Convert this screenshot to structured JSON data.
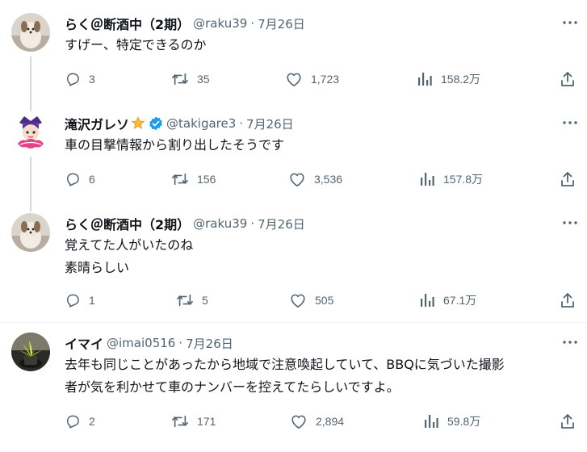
{
  "tweets": [
    {
      "name": "らく＠断酒中（2期）",
      "handle": "@raku39",
      "separator": "·",
      "date": "7月26日",
      "verified": false,
      "lines": [
        "すげー、特定できるのか"
      ],
      "replies": "3",
      "retweets": "35",
      "likes": "1,723",
      "views": "158.2万"
    },
    {
      "name": "滝沢ガレソ",
      "name_emoji": "star-emoji",
      "handle": "@takigare3",
      "separator": "·",
      "date": "7月26日",
      "verified": true,
      "lines": [
        "車の目撃情報から割り出したそうです"
      ],
      "replies": "6",
      "retweets": "156",
      "likes": "3,536",
      "views": "157.8万"
    },
    {
      "name": "らく＠断酒中（2期）",
      "handle": "@raku39",
      "separator": "·",
      "date": "7月26日",
      "verified": false,
      "lines": [
        "覚えてた人がいたのね",
        "素晴らしい"
      ],
      "replies": "1",
      "retweets": "5",
      "likes": "505",
      "views": "67.1万"
    },
    {
      "name": "イマイ",
      "handle": "@imai0516",
      "separator": "·",
      "date": "7月26日",
      "verified": false,
      "lines": [
        "去年も同じことがあったから地域で注意喚起していて、BBQに気づいた撮影",
        "者が気を利かせて車のナンバーを控えてたらしいですよ。"
      ],
      "replies": "2",
      "retweets": "171",
      "likes": "2,894",
      "views": "59.8万"
    }
  ],
  "colors": {
    "text": "#0f1419",
    "secondary": "#536471",
    "verified": "#1d9bf0",
    "thread_line": "#cfd9de",
    "divider": "#eff3f4"
  }
}
